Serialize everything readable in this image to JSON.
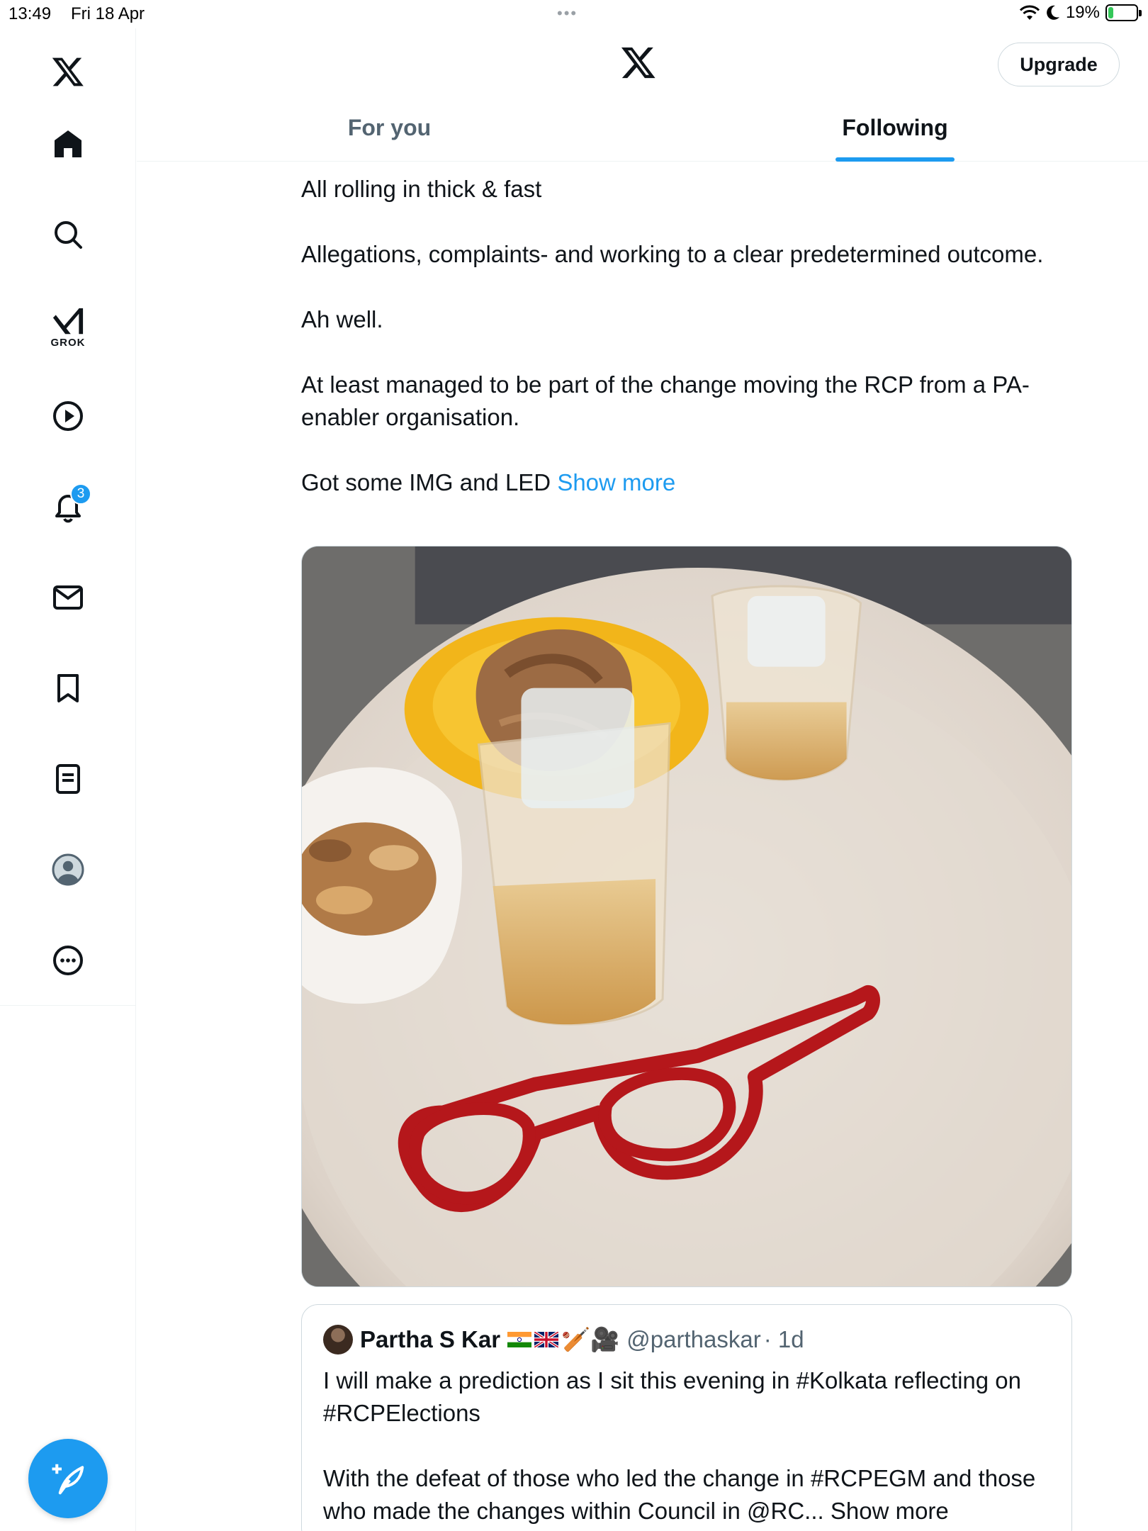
{
  "status_bar": {
    "time": "13:49",
    "date": "Fri 18 Apr",
    "dots": "•••",
    "battery": "19%",
    "battery_level": 0.19
  },
  "sidebar": {
    "items": [
      {
        "name": "home",
        "icon": "home-icon"
      },
      {
        "name": "search",
        "icon": "search-icon"
      },
      {
        "name": "grok",
        "icon": "grok-icon",
        "label": "GROK"
      },
      {
        "name": "video",
        "icon": "play-icon"
      },
      {
        "name": "notifications",
        "icon": "bell-icon",
        "badge": "3"
      },
      {
        "name": "messages",
        "icon": "mail-icon"
      },
      {
        "name": "bookmarks",
        "icon": "bookmark-icon"
      },
      {
        "name": "lists",
        "icon": "list-icon"
      },
      {
        "name": "profile",
        "icon": "avatar-icon"
      },
      {
        "name": "more",
        "icon": "more-icon"
      }
    ],
    "compose_icon": "compose-icon"
  },
  "header": {
    "upgrade_label": "Upgrade",
    "tabs": [
      {
        "label": "For you",
        "active": false
      },
      {
        "label": "Following",
        "active": true
      }
    ]
  },
  "tweet": {
    "paragraphs": [
      "All rolling in thick & fast",
      "Allegations, complaints- and working to a clear predetermined outcome.",
      "Ah well.",
      "At least managed to be part of the change moving the RCP from a PA-enabler organisation."
    ],
    "last_line": "Got some IMG and LED",
    "show_more": "Show more"
  },
  "quote": {
    "name": "Partha S Kar",
    "handle": "@parthaskar",
    "time": "· 1d",
    "emoji": "🏏🎥",
    "paragraph1": "I will make a prediction as I sit this evening in #Kolkata reflecting on #RCPElections",
    "paragraph2": "With the defeat of those who led the change in #RCPEGM and those who made the changes within Council in @RC...",
    "show_more": "Show more"
  },
  "colors": {
    "accent": "#1d9bf0",
    "text": "#0f1419",
    "muted": "#536471",
    "border": "#cfd9de"
  }
}
